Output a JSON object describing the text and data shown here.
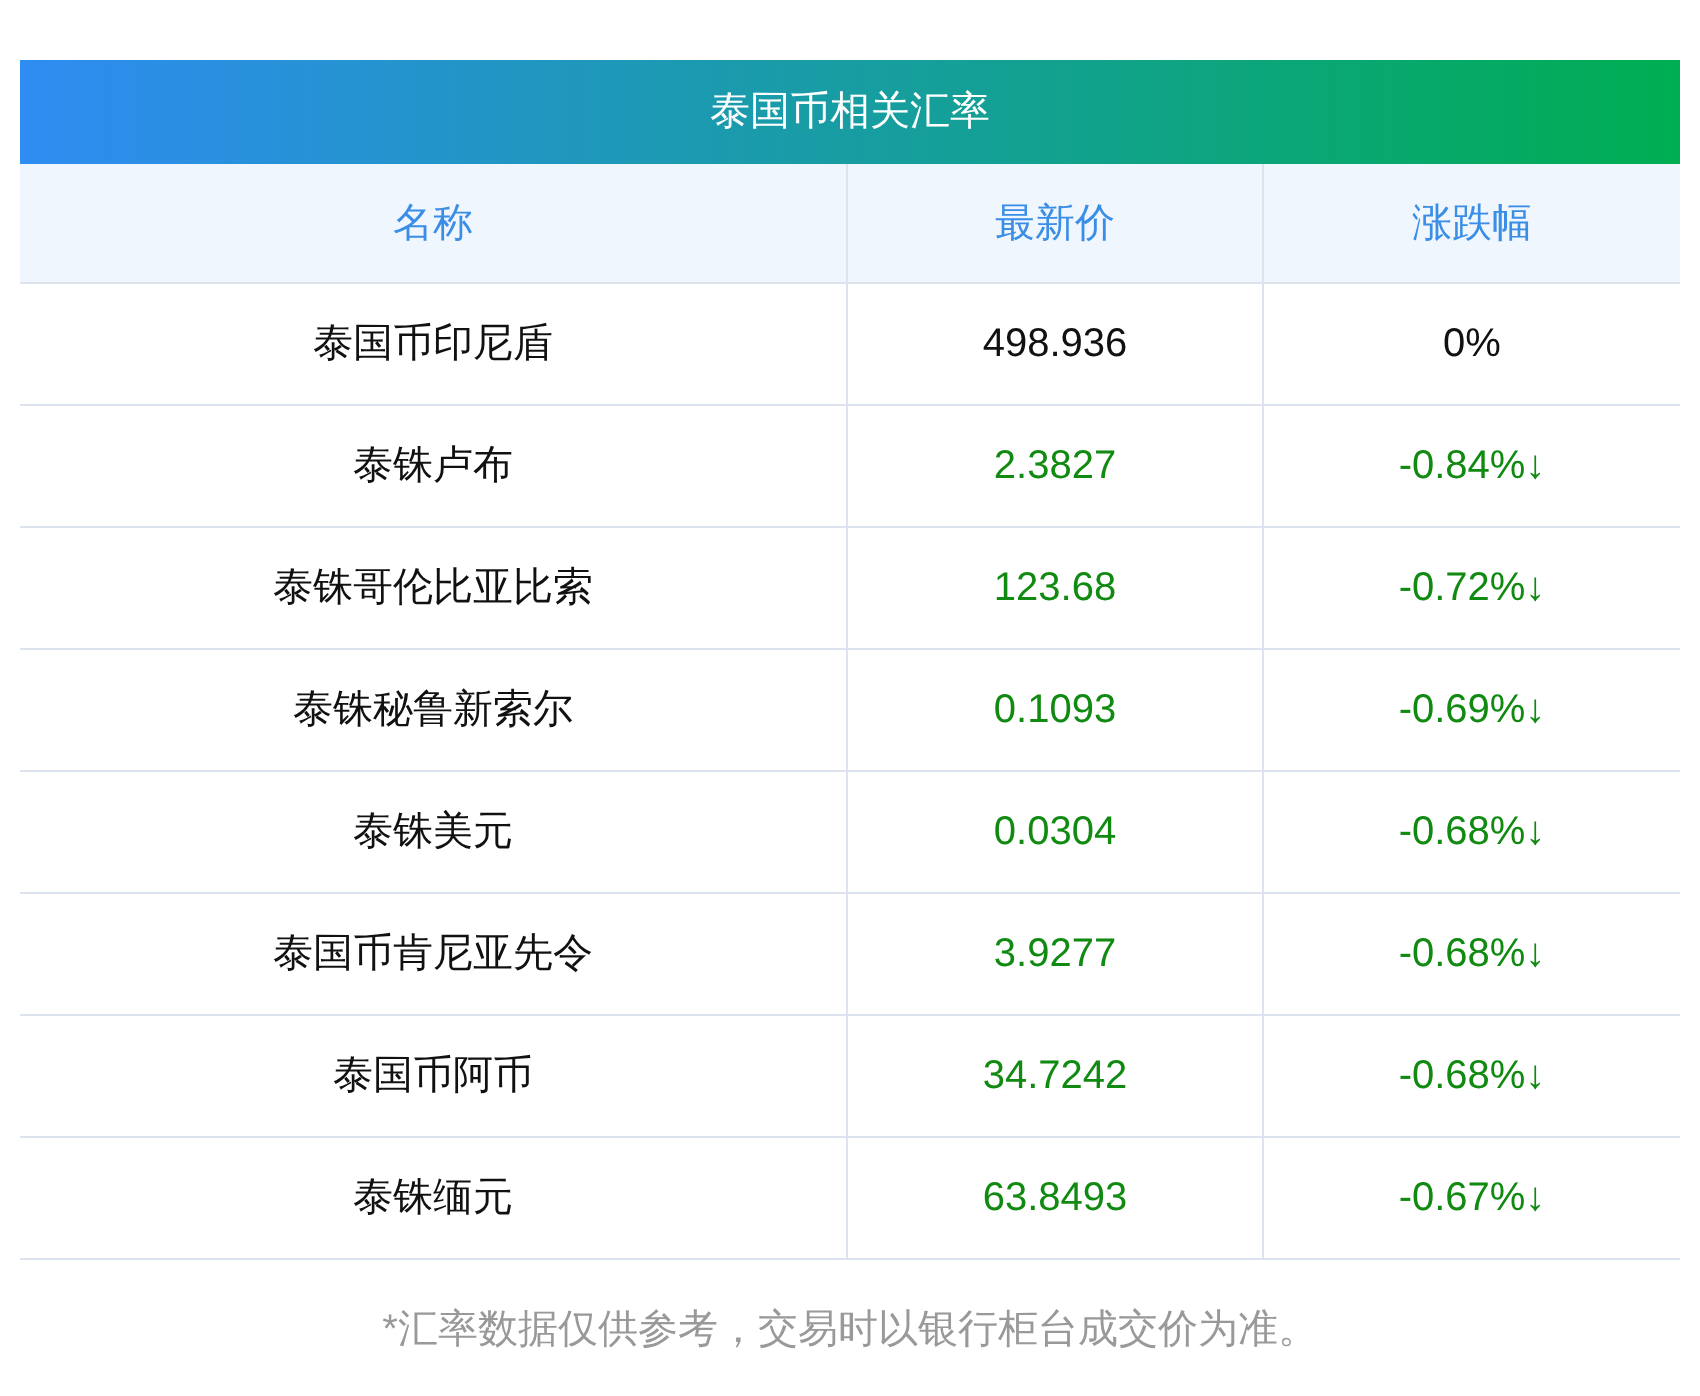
{
  "title": "泰国币相关汇率",
  "columns": [
    "名称",
    "最新价",
    "涨跌幅"
  ],
  "rows": [
    {
      "name": "泰国币印尼盾",
      "price": "498.936",
      "change": "0%",
      "color": "#111111"
    },
    {
      "name": "泰铢卢布",
      "price": "2.3827",
      "change": "-0.84%↓",
      "color": "#118a11"
    },
    {
      "name": "泰铢哥伦比亚比索",
      "price": "123.68",
      "change": "-0.72%↓",
      "color": "#118a11"
    },
    {
      "name": "泰铢秘鲁新索尔",
      "price": "0.1093",
      "change": "-0.69%↓",
      "color": "#118a11"
    },
    {
      "name": "泰铢美元",
      "price": "0.0304",
      "change": "-0.68%↓",
      "color": "#118a11"
    },
    {
      "name": "泰国币肯尼亚先令",
      "price": "3.9277",
      "change": "-0.68%↓",
      "color": "#118a11"
    },
    {
      "name": "泰国币阿币",
      "price": "34.7242",
      "change": "-0.68%↓",
      "color": "#118a11"
    },
    {
      "name": "泰铢缅元",
      "price": "63.8493",
      "change": "-0.67%↓",
      "color": "#118a11"
    }
  ],
  "footnote": "*汇率数据仅供参考，交易时以银行柜台成交价为准。"
}
